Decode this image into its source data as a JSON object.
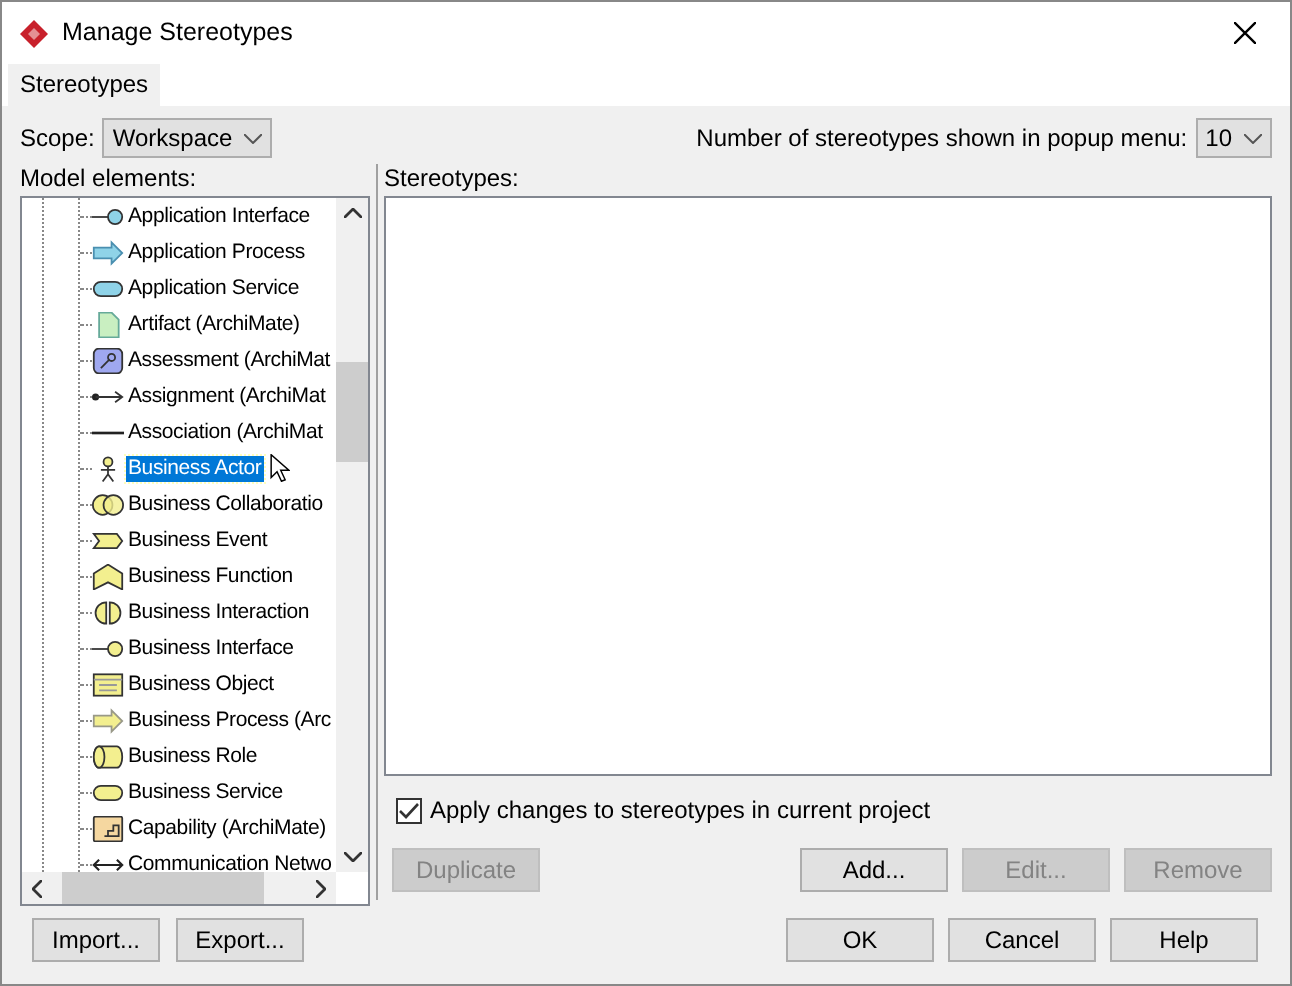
{
  "window": {
    "title": "Manage Stereotypes"
  },
  "tabs": [
    {
      "label": "Stereotypes",
      "selected": true
    }
  ],
  "scope": {
    "label": "Scope:",
    "value": "Workspace"
  },
  "popup_count": {
    "label": "Number of stereotypes shown in popup menu:",
    "value": "10"
  },
  "model_elements": {
    "label": "Model elements:",
    "items": [
      {
        "label": "Application Interface",
        "kind": "app-interface",
        "selected": false
      },
      {
        "label": "Application Process",
        "kind": "app-process",
        "selected": false
      },
      {
        "label": "Application Service",
        "kind": "app-service",
        "selected": false
      },
      {
        "label": "Artifact (ArchiMate)",
        "kind": "artifact",
        "selected": false
      },
      {
        "label": "Assessment (ArchiMat",
        "kind": "assessment",
        "selected": false
      },
      {
        "label": "Assignment (ArchiMat",
        "kind": "assignment",
        "selected": false
      },
      {
        "label": "Association (ArchiMat",
        "kind": "association",
        "selected": false
      },
      {
        "label": "Business Actor",
        "kind": "actor",
        "selected": true
      },
      {
        "label": "Business Collaboratio",
        "kind": "collaboration",
        "selected": false
      },
      {
        "label": "Business Event",
        "kind": "event",
        "selected": false
      },
      {
        "label": "Business Function",
        "kind": "function",
        "selected": false
      },
      {
        "label": "Business Interaction",
        "kind": "interaction",
        "selected": false
      },
      {
        "label": "Business Interface",
        "kind": "biz-interface",
        "selected": false
      },
      {
        "label": "Business Object",
        "kind": "object",
        "selected": false
      },
      {
        "label": "Business Process (Arc",
        "kind": "biz-process",
        "selected": false
      },
      {
        "label": "Business Role",
        "kind": "role",
        "selected": false
      },
      {
        "label": "Business Service",
        "kind": "biz-service",
        "selected": false
      },
      {
        "label": "Capability (ArchiMate)",
        "kind": "capability",
        "selected": false
      },
      {
        "label": "Communication Netwo",
        "kind": "network",
        "selected": false
      }
    ]
  },
  "stereotypes": {
    "label": "Stereotypes:"
  },
  "apply_changes": {
    "label": "Apply changes to stereotypes in current project",
    "checked": true
  },
  "list_buttons": [
    {
      "label": "Duplicate",
      "disabled": true
    },
    {
      "label": "Add...",
      "disabled": false
    },
    {
      "label": "Edit...",
      "disabled": true
    },
    {
      "label": "Remove",
      "disabled": true
    }
  ],
  "left_buttons": [
    {
      "label": "Import..."
    },
    {
      "label": "Export..."
    }
  ],
  "dialog_buttons": [
    {
      "label": "OK"
    },
    {
      "label": "Cancel"
    },
    {
      "label": "Help"
    }
  ]
}
